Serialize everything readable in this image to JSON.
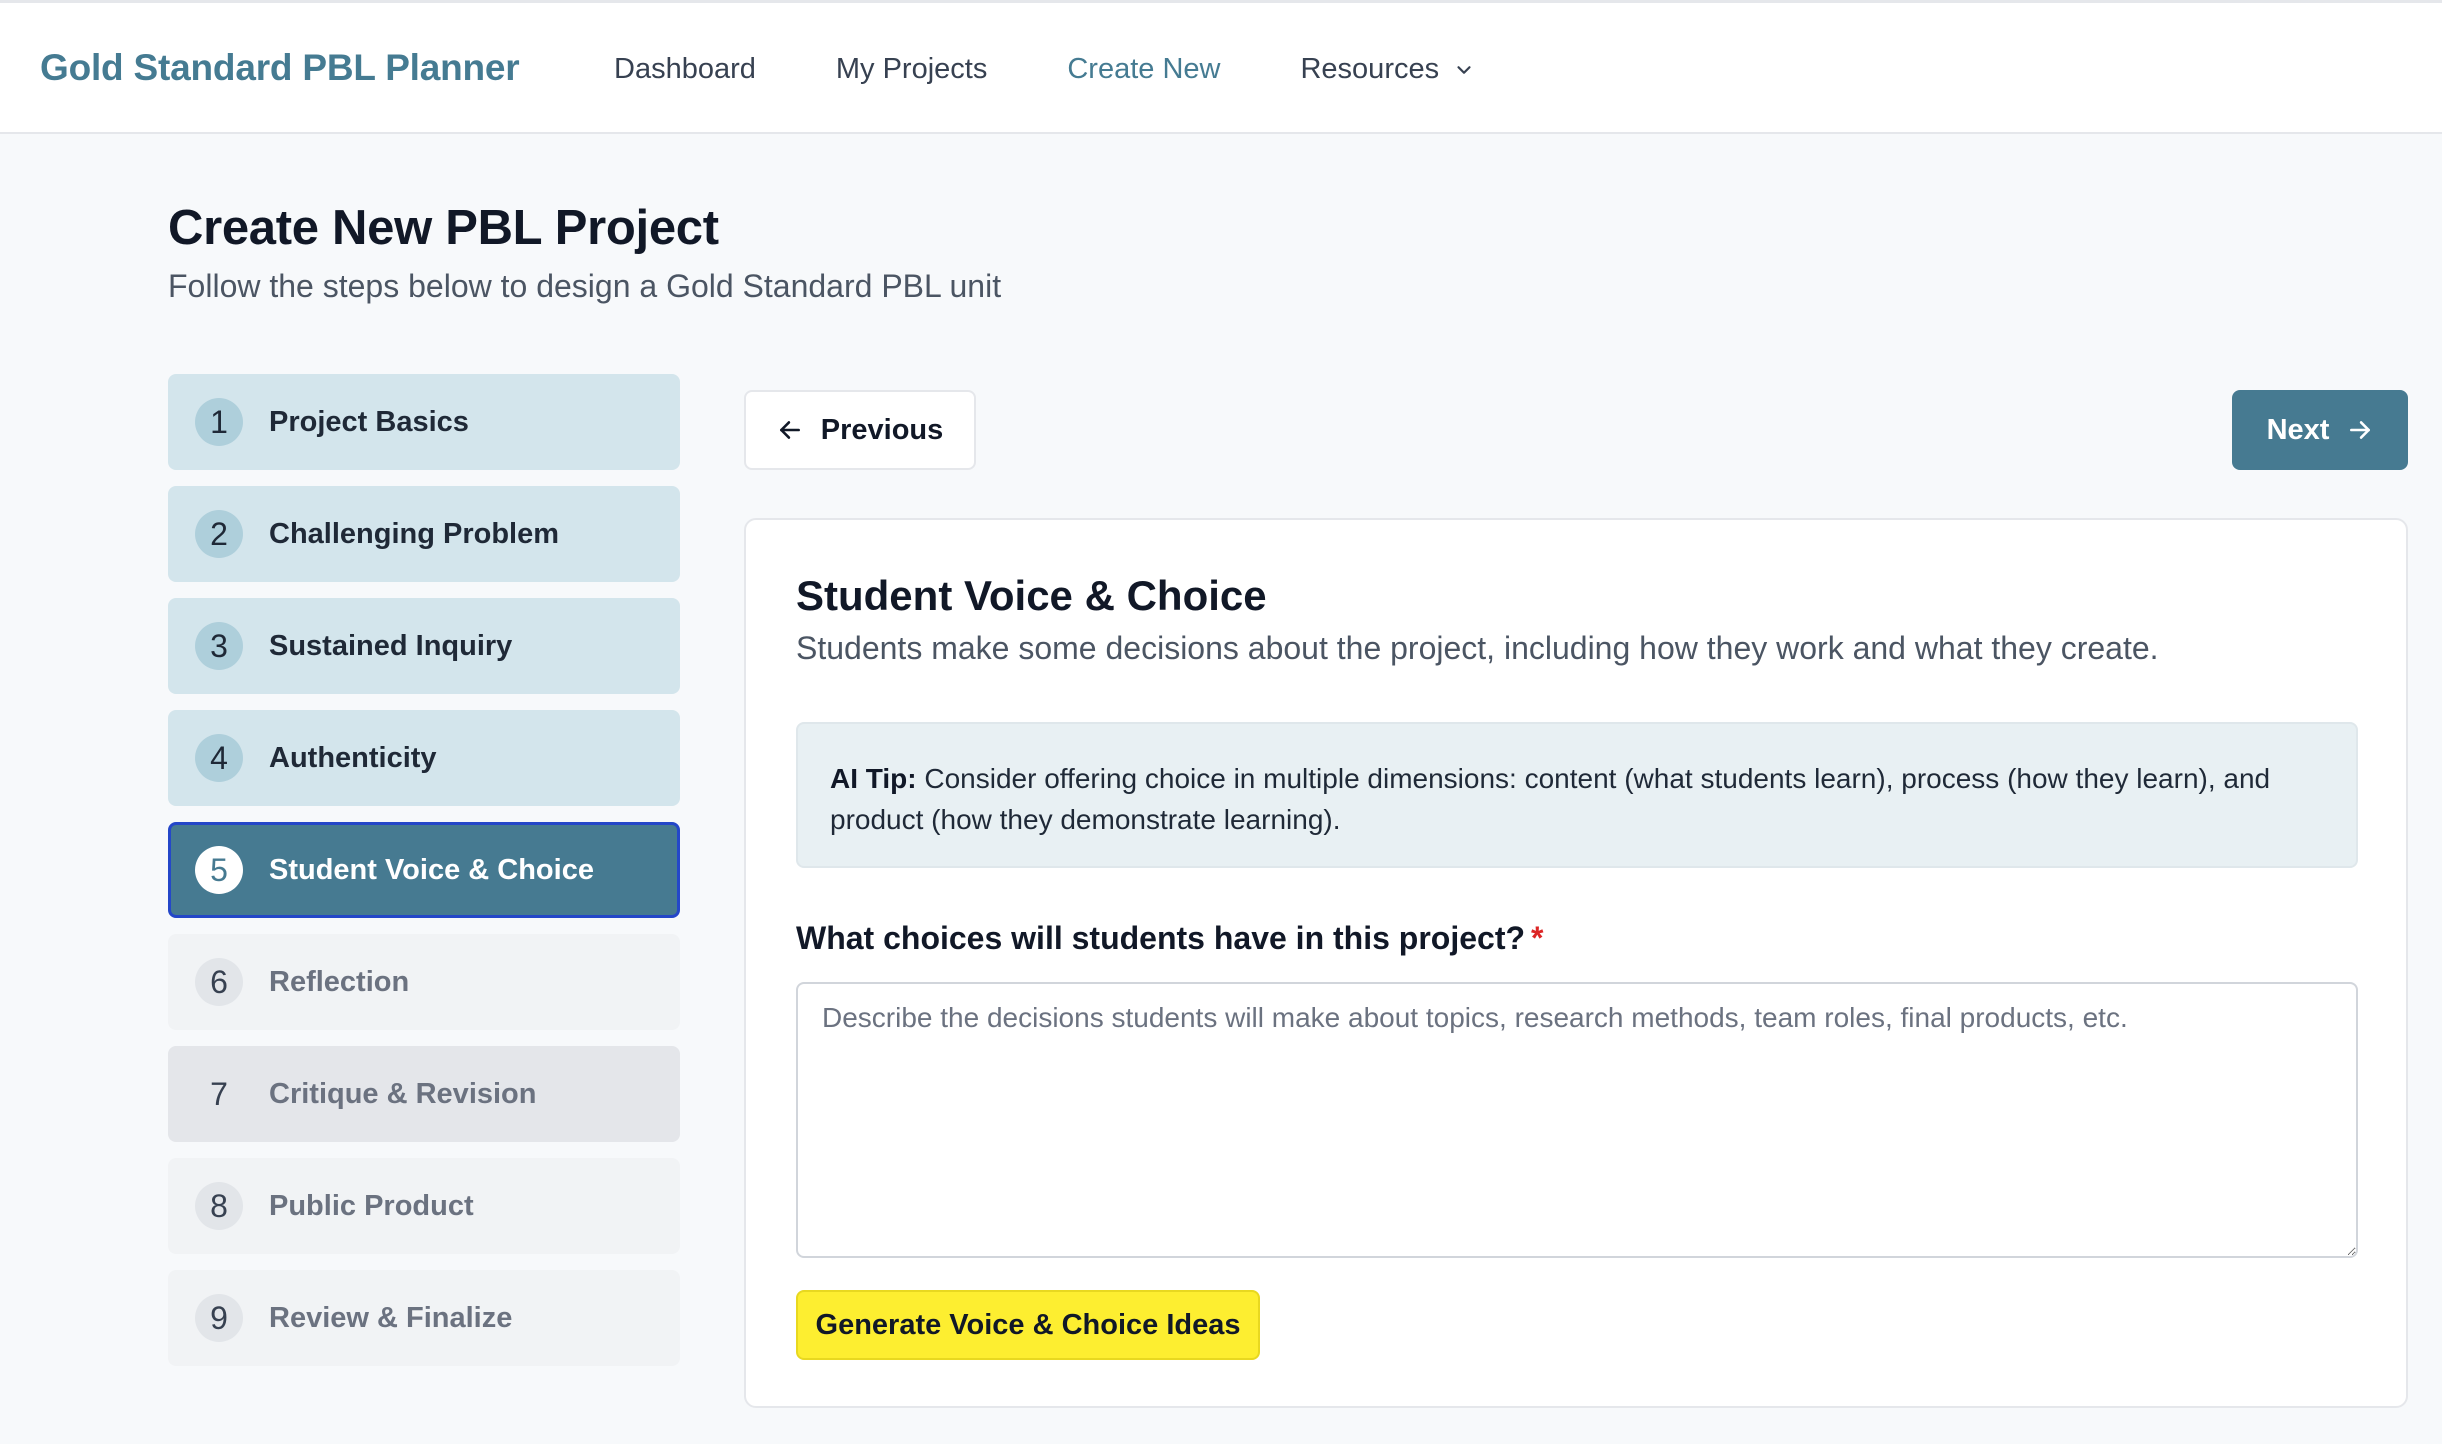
{
  "app": {
    "title": "Gold Standard PBL Planner"
  },
  "nav": {
    "items": [
      {
        "label": "Dashboard",
        "active": false
      },
      {
        "label": "My Projects",
        "active": false
      },
      {
        "label": "Create New",
        "active": true
      },
      {
        "label": "Resources",
        "active": false,
        "has_dropdown": true
      }
    ]
  },
  "page": {
    "title": "Create New PBL Project",
    "subtitle": "Follow the steps below to design a Gold Standard PBL unit"
  },
  "steps": [
    {
      "num": "1",
      "label": "Project Basics",
      "state": "done"
    },
    {
      "num": "2",
      "label": "Challenging Problem",
      "state": "done"
    },
    {
      "num": "3",
      "label": "Sustained Inquiry",
      "state": "done"
    },
    {
      "num": "4",
      "label": "Authenticity",
      "state": "done"
    },
    {
      "num": "5",
      "label": "Student Voice & Choice",
      "state": "current"
    },
    {
      "num": "6",
      "label": "Reflection",
      "state": "upcoming"
    },
    {
      "num": "7",
      "label": "Critique & Revision",
      "state": "hover"
    },
    {
      "num": "8",
      "label": "Public Product",
      "state": "upcoming"
    },
    {
      "num": "9",
      "label": "Review & Finalize",
      "state": "upcoming"
    }
  ],
  "buttons": {
    "previous": "Previous",
    "next": "Next",
    "generate": "Generate Voice & Choice Ideas"
  },
  "section": {
    "title": "Student Voice & Choice",
    "description": "Students make some decisions about the project, including how they work and what they create.",
    "tip_label": "AI Tip:",
    "tip_text": " Consider offering choice in multiple dimensions: content (what students learn), process (how they learn), and product (how they demonstrate learning).",
    "question": "What choices will students have in this project?",
    "required_mark": "*",
    "answer_value": "",
    "answer_placeholder": "Describe the decisions students will make about topics, research methods, team roles, final products, etc."
  },
  "colors": {
    "brand": "#457b92",
    "step_done": "#d3e5ec",
    "step_current": "#467a91",
    "step_current_border": "#2447c9",
    "tip_bg": "#e8f0f3",
    "generate_bg": "#fdee30",
    "required": "#dc2626"
  },
  "icons": {
    "resources_dropdown": "chevron-down-icon",
    "previous": "arrow-left-icon",
    "next": "arrow-right-icon"
  }
}
